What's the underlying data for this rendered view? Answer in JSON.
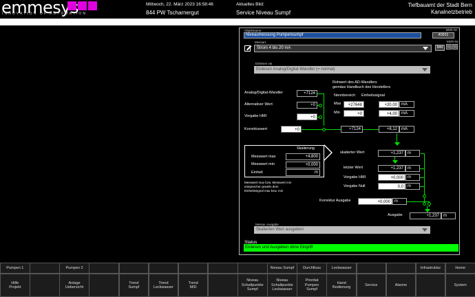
{
  "header": {
    "logo_main": "emmesys",
    "logo_sub": "INNOVATION OF AUTOMATION",
    "datetime": "Mittwoch, 22. März 2023 16:58:46",
    "station": "844 PW Tscharnergut",
    "current_view_label": "Aktuelles Bild:",
    "current_view": "Service Niveau Sumpf",
    "org_line1": "Tiefbauamt der Stadt Bern",
    "org_line2": "Kanalnetzbetrieb"
  },
  "panel": {
    "objname_label": "Objektname",
    "objname_value": "Niveaumessung Pumpensumpf",
    "bmk_label": "BMK-Nr.",
    "bmk_value": "40911",
    "messart_label": "Messart",
    "messart_value": "Strom 4 bis 20 mA",
    "station_no": "844",
    "msr_label": "MSR-Nr.",
    "msr_d1": "11",
    "msr_d2": "11",
    "einlesen_label": "Einlesen via",
    "einlesen_value": "Einlesen Analog/Digital-Wandler (= normal)",
    "rohwert_title1": "Rohwert des AD-Wandlers",
    "rohwert_title2": "gemäss Handbuch des Herstellers",
    "nennbereich_label": "Nennbereich",
    "einheitssignal_label": "Einheitssignal",
    "max_label": "Max",
    "min_label": "Min",
    "nenn_max": "+27648",
    "nenn_min": "+0",
    "sig_max": "+20,00",
    "sig_min": "+4,00",
    "unit_ma": "mA",
    "adw_label": "Analog/Digital-Wandler",
    "adw_value": "+7124",
    "altwert_label": "Alternativer Wert",
    "altwert_value": "+0",
    "vorgabe_hmi_label": "Vorgabe HMI",
    "vorgabe_hmi_value": "+0",
    "korrektur_label": "Korrekturwert",
    "korrektur_value": "+0",
    "mid_value": "+7124",
    "ma_value": "+8,12",
    "skal_title": "Skalierung",
    "mess_max_label": "Messwert max",
    "mess_max_value": "+4,800",
    "mess_min_label": "Messwert min",
    "mess_min_value": "+0,000",
    "einheit_label": "Einheit",
    "einheit_value": "m",
    "note": "Messwert max bzw. Messwert min\nentsprechen jeweils dem\nEinheitssignal max bzw. min",
    "skal_wert_label": "skalierter Wert",
    "skal_wert_value": "+1,237",
    "unit_m": "m",
    "letzter_label": "letzter Wert",
    "letzter_value": "+1,237",
    "vhmi2_label": "Vorgabe HMI",
    "vhmi2_value": "+0,000",
    "vnull_label": "Vorgabe Null",
    "vnull_value": "0,0",
    "kor_ausg_label": "Korrektur Ausgabe",
    "kor_ausg_value": "+0,000",
    "ausgabe_label": "Ausgabe",
    "ausgabe_value": "+1,237",
    "wert_ausgabe_label": "Messw. Ausgabe",
    "wert_ausgabe_value": "Skalierten Wert ausgeben",
    "status_label": "Status",
    "status_value": "Einlesen und Ausgeben ohne Eingriff",
    "status_color": "#00ff00"
  },
  "nav": {
    "top": [
      "Pumpen 1",
      "",
      "Pumpen 2",
      "",
      "",
      "",
      "",
      "",
      "",
      "Niveau Sumpf",
      "Durchfluss",
      "Leckwasser",
      "",
      "",
      "Infrastruktur",
      "Home"
    ],
    "bottom": [
      "Hilfe\nProjekt",
      "",
      "Anlage\nUebersicht",
      "",
      "Trend\nSumpf",
      "Trend\nLeckwasser",
      "Trend\nMID",
      "",
      "Niveau\nSchaltpunkte\nSumpf",
      "Niveau\nSchaltpunkte\nLeckwasser",
      "Prioritat\nPumpen\nSumpf",
      "Hand\nBedienung",
      "Service",
      "Alarme",
      "",
      "System"
    ]
  }
}
